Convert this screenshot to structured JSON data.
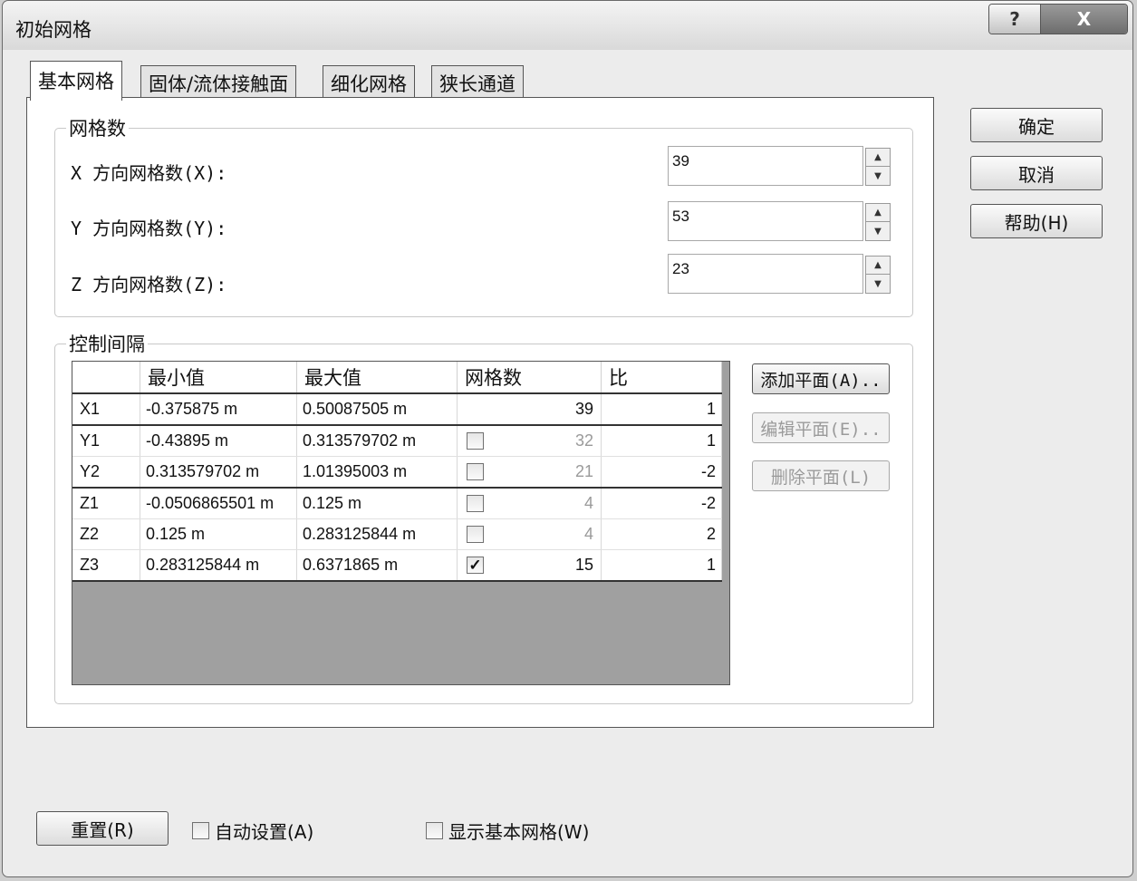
{
  "window": {
    "title": "初始网格"
  },
  "caption": {
    "help": "?",
    "close": "X"
  },
  "tabs": [
    {
      "label": "基本网格"
    },
    {
      "label": "固体/流体接触面"
    },
    {
      "label": "细化网格"
    },
    {
      "label": "狭长通道"
    }
  ],
  "cell_count": {
    "legend": "网格数",
    "x": {
      "label": "X 方向网格数(X):",
      "value": "39"
    },
    "y": {
      "label": "Y 方向网格数(Y):",
      "value": "53"
    },
    "z": {
      "label": "Z 方向网格数(Z):",
      "value": "23"
    }
  },
  "control_intervals": {
    "legend": "控制间隔",
    "columns": [
      "",
      "最小值",
      "最大值",
      "网格数",
      "比"
    ],
    "rows": [
      {
        "name": "X1",
        "min": "-0.375875 m",
        "max": "0.50087505 m",
        "checkbox": false,
        "checked": false,
        "cells": "39",
        "ratio": "1"
      },
      {
        "name": "Y1",
        "min": "-0.43895 m",
        "max": "0.313579702 m",
        "checkbox": true,
        "checked": false,
        "cells": "32",
        "ratio": "1"
      },
      {
        "name": "Y2",
        "min": "0.313579702 m",
        "max": "1.01395003 m",
        "checkbox": true,
        "checked": false,
        "cells": "21",
        "ratio": "-2"
      },
      {
        "name": "Z1",
        "min": "-0.0506865501 m",
        "max": "0.125 m",
        "checkbox": true,
        "checked": false,
        "cells": "4",
        "ratio": "-2"
      },
      {
        "name": "Z2",
        "min": "0.125 m",
        "max": "0.283125844 m",
        "checkbox": true,
        "checked": false,
        "cells": "4",
        "ratio": "2"
      },
      {
        "name": "Z3",
        "min": "0.283125844 m",
        "max": "0.6371865 m",
        "checkbox": true,
        "checked": true,
        "cells": "15",
        "ratio": "1"
      }
    ],
    "buttons": {
      "add": "添加平面(A)..",
      "edit": "编辑平面(E)..",
      "delete": "删除平面(L)"
    }
  },
  "dialog_buttons": {
    "ok": "确定",
    "cancel": "取消",
    "help": "帮助(H)"
  },
  "bottom": {
    "reset": "重置(R)",
    "auto_settings": "自动设置(A)",
    "show_basic_mesh": "显示基本网格(W)"
  },
  "colors": {
    "window_bg": "#ececec",
    "panel_bg": "#ffffff",
    "grid_empty": "#a0a0a0"
  }
}
